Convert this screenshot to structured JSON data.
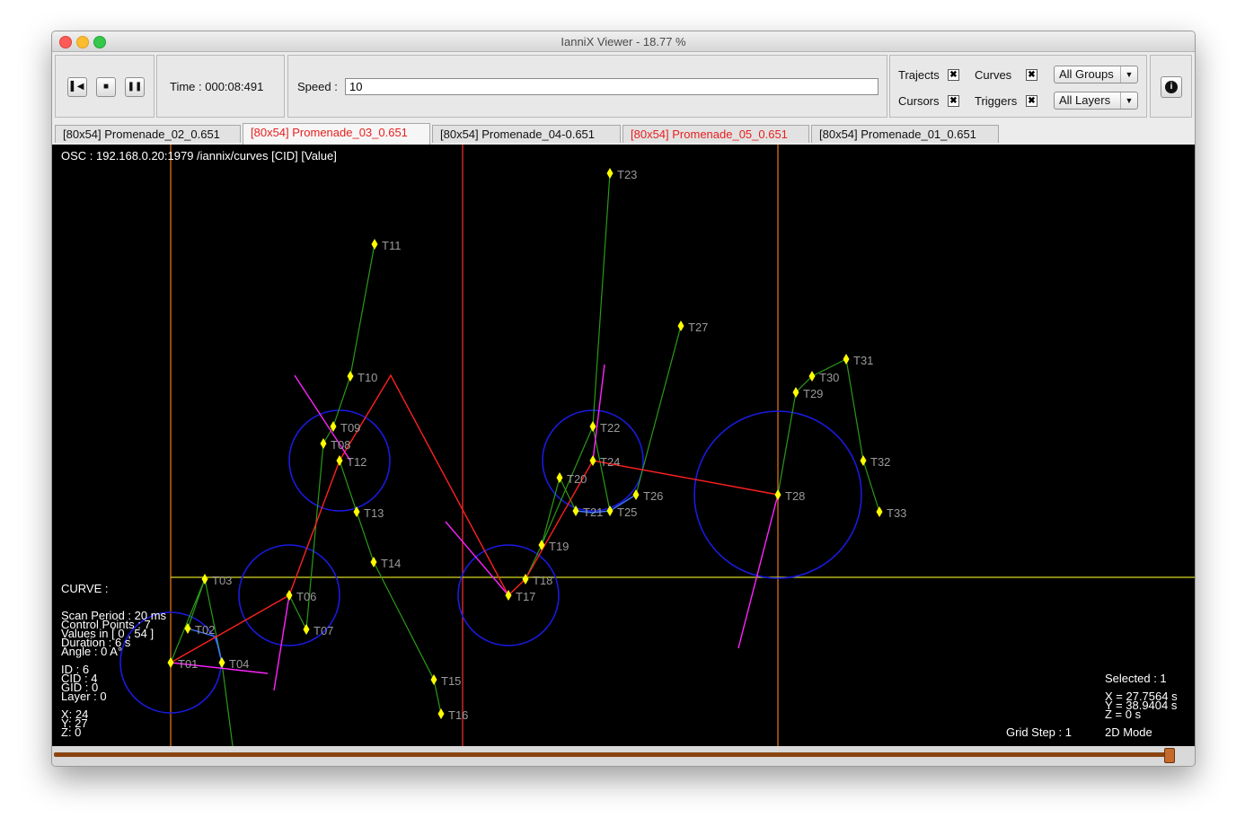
{
  "window": {
    "title": "IanniX Viewer - 18.77 %",
    "time_label": "Time : 000:08:491",
    "speed_label": "Speed :",
    "speed_value": "10",
    "transport": {
      "rewind_icon": "rewind-icon",
      "stop_icon": "stop-icon",
      "pause_icon": "pause-icon"
    },
    "toggles": {
      "trajects": {
        "label": "Trajects",
        "checked": true
      },
      "curves": {
        "label": "Curves",
        "checked": true
      },
      "cursors": {
        "label": "Cursors",
        "checked": true
      },
      "triggers": {
        "label": "Triggers",
        "checked": true
      }
    },
    "groups_select": "All Groups",
    "layers_select": "All Layers",
    "info_icon": "info-icon"
  },
  "tabs": [
    {
      "label": "[80x54] Promenade_02_0.651",
      "color": "#111111"
    },
    {
      "label": "[80x54] Promenade_03_0.651",
      "color": "#e82020"
    },
    {
      "label": "[80x54] Promenade_04-0.651",
      "color": "#111111"
    },
    {
      "label": "[80x54] Promenade_05_0.651",
      "color": "#e82020"
    },
    {
      "label": "[80x54] Promenade_01_0.651",
      "color": "#111111"
    }
  ],
  "canvas": {
    "osc": "OSC :    192.168.0.20:1979   /iannix/curves [CID] [Value]",
    "info_left": {
      "curve": "CURVE :",
      "scan_period": "Scan Period : 20 ms",
      "control_points": "Control Points : 7",
      "values": "Values in [ 0 , 54 ]",
      "duration": "Duration : 6 s",
      "angle": "Angle : 0 A°",
      "id": "ID : 6",
      "cid": "CID : 4",
      "gid": "GID : 0",
      "layer": "Layer : 0",
      "x": "X: 24",
      "y": "Y: 27",
      "z": "Z: 0"
    },
    "info_right": {
      "selected": "Selected : 1",
      "x": "X = 27.7564 s",
      "y": "Y = 38.9404 s",
      "z": "Z = 0 s",
      "grid_step": "Grid Step : 1",
      "mode": "2D Mode"
    },
    "colors": {
      "background": "#000000",
      "trigger": "#ffff00",
      "trigger_label": "#9a9a9a",
      "green_curve": "#2a9a18",
      "red_curve": "#ff2020",
      "magenta": "#ff22ff",
      "circle": "#1a1ae0",
      "cursor_vertical": "#f07820",
      "cursor_red": "#ff3030",
      "horizontal": "#d8d820"
    },
    "triggers": [
      "T01",
      "T02",
      "T03",
      "T04",
      "T06",
      "T07",
      "T08",
      "T09",
      "T10",
      "T11",
      "T12",
      "T13",
      "T14",
      "T15",
      "T16",
      "T17",
      "T18",
      "T19",
      "T20",
      "T21",
      "T22",
      "T23",
      "T24",
      "T25",
      "T26",
      "T27",
      "T28",
      "T29",
      "T30",
      "T31",
      "T32",
      "T33"
    ]
  }
}
